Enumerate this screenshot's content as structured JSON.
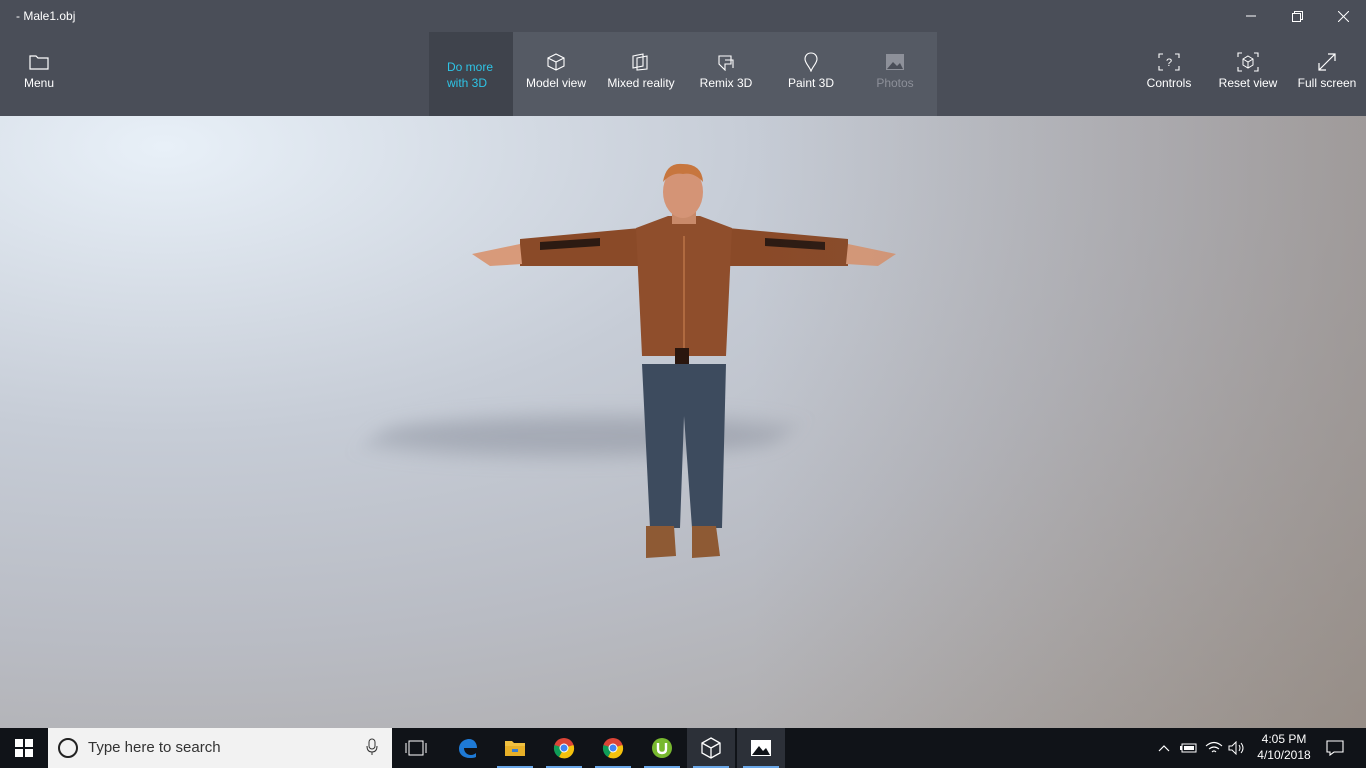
{
  "window": {
    "title": "- Male1.obj"
  },
  "toolbar": {
    "menu": "Menu",
    "do_more": "Do more\nwith 3D",
    "model_view": "Model view",
    "mixed_reality": "Mixed reality",
    "remix_3d": "Remix 3D",
    "paint_3d": "Paint 3D",
    "photos": "Photos",
    "controls": "Controls",
    "reset_view": "Reset view",
    "full_screen": "Full screen"
  },
  "taskbar": {
    "search_placeholder": "Type here to search",
    "time": "4:05 PM",
    "date": "4/10/2018",
    "apps": [
      "task-view-icon",
      "edge-icon",
      "file-explorer-icon",
      "chrome-icon",
      "chrome-icon",
      "utorrent-icon",
      "3d-viewer-icon",
      "photos-icon"
    ]
  },
  "colors": {
    "toolbar": "#4a4e58",
    "accent": "#2ec4e6",
    "taskbar": "#101318"
  }
}
